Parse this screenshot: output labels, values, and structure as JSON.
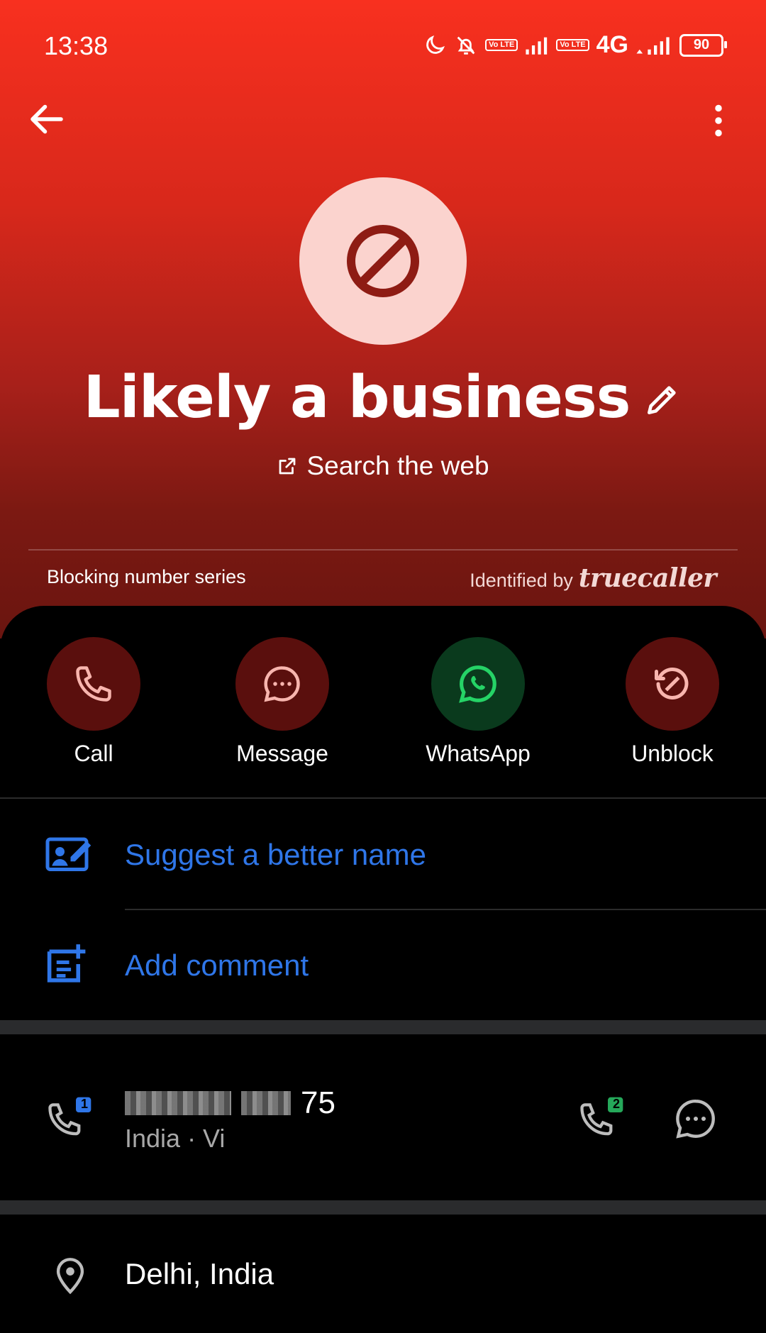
{
  "status_bar": {
    "time": "13:38",
    "network": "4G",
    "volte_1": "Vo LTE",
    "volte_2": "Vo LTE",
    "battery": "90"
  },
  "header": {
    "back_icon": "arrow-left-icon",
    "more_icon": "more-vertical-icon"
  },
  "profile": {
    "avatar_icon": "block-icon",
    "title": "Likely a business",
    "search_web": "Search the web",
    "blocking_label": "Blocking number series",
    "identified_label": "Identified by",
    "brand": "truecaller"
  },
  "actions": [
    {
      "label": "Call",
      "icon": "phone-icon"
    },
    {
      "label": "Message",
      "icon": "message-icon"
    },
    {
      "label": "WhatsApp",
      "icon": "whatsapp-icon"
    },
    {
      "label": "Unblock",
      "icon": "unblock-icon"
    }
  ],
  "links": {
    "suggest_name": "Suggest a better name",
    "add_comment": "Add comment"
  },
  "number": {
    "visible_tail": "75",
    "carrier": "India · Vi",
    "sim1_badge": "1",
    "sim2_badge": "2"
  },
  "location": "Delhi, India",
  "colors": {
    "accent_blue": "#2f76e8",
    "hero_red": "#f8301f",
    "action_red_bg": "#5a0f0d",
    "whatsapp_bg": "#0a3a1d",
    "whatsapp_green": "#25d366"
  }
}
